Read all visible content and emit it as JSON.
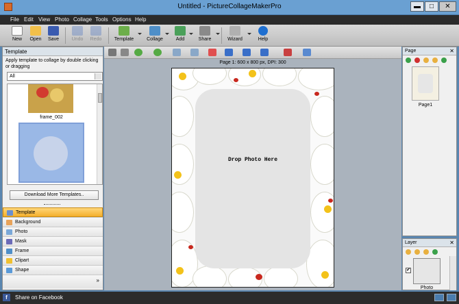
{
  "window": {
    "title": "Untitled - PictureCollageMakerPro",
    "min": "▬",
    "max": "□",
    "close": "✕"
  },
  "menu": [
    "File",
    "Edit",
    "View",
    "Photo",
    "Collage",
    "Tools",
    "Options",
    "Help"
  ],
  "toolbar": {
    "new": "New",
    "open": "Open",
    "save": "Save",
    "undo": "Undo",
    "redo": "Redo",
    "template": "Template",
    "collage": "Collage",
    "add": "Add",
    "share": "Share",
    "wizard": "Wizard",
    "help": "Help"
  },
  "left_panel": {
    "header": "Template",
    "description": "Apply template to collage by double clicking or dragging",
    "filter_value": "All",
    "thumb_caption": "frame_002",
    "download_button": "Download More Templates..",
    "categories": [
      "Template",
      "Background",
      "Photo",
      "Mask",
      "Frame",
      "Clipart",
      "Shape"
    ]
  },
  "canvas": {
    "page_caption": "Page 1: 600 x 800 px, DPI: 300",
    "drop_text": "Drop Photo Here"
  },
  "page_panel": {
    "header": "Page",
    "close": "✕",
    "page_label": "Page1"
  },
  "layer_panel": {
    "header": "Layer",
    "close": "✕",
    "checkbox": "✔",
    "layer_label": "Photo"
  },
  "status": {
    "share_label": "Share on Facebook",
    "fb_icon": "f"
  },
  "colors": {
    "accent_category": "#f4ae2b",
    "titlebar": "#6aa0d2",
    "menubar": "#2b2b2b"
  }
}
